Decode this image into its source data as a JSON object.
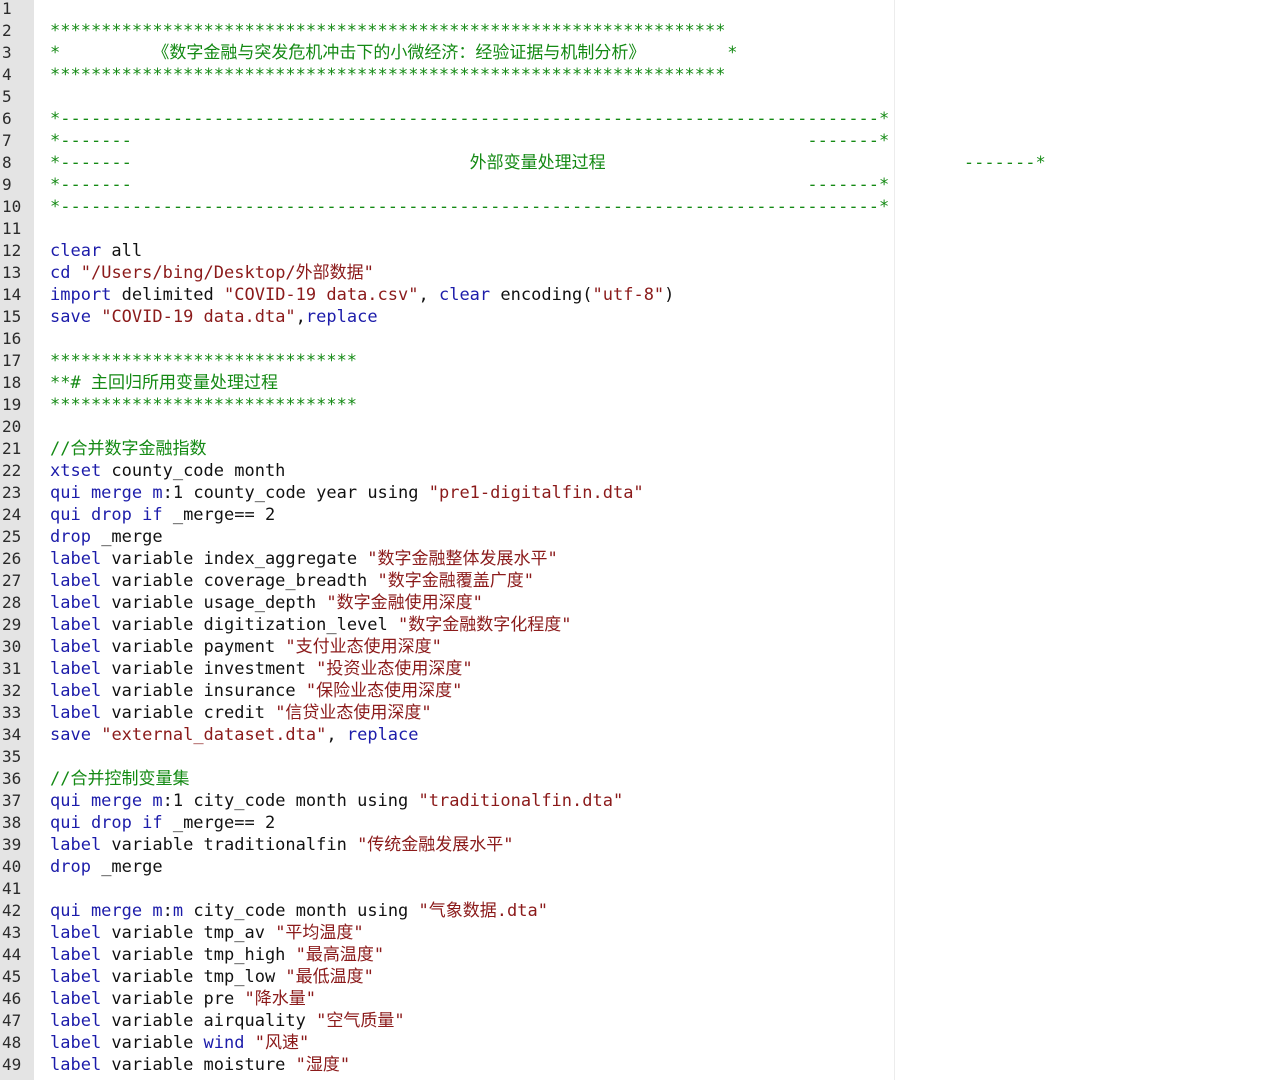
{
  "editor": {
    "line_numbers": [
      "1",
      "2",
      "3",
      "4",
      "5",
      "6",
      "7",
      "8",
      "9",
      "10",
      "11",
      "12",
      "13",
      "14",
      "15",
      "16",
      "17",
      "18",
      "19",
      "20",
      "21",
      "22",
      "23",
      "24",
      "25",
      "26",
      "27",
      "28",
      "29",
      "30",
      "31",
      "32",
      "33",
      "34",
      "35",
      "36",
      "37",
      "38",
      "39",
      "40",
      "41",
      "42",
      "43",
      "44",
      "45",
      "46",
      "47",
      "48",
      "49"
    ],
    "lines": [
      [],
      [
        {
          "t": "comment",
          "v": "******************************************************************"
        }
      ],
      [
        {
          "t": "comment",
          "v": "*         《数字金融与突发危机冲击下的小微经济：经验证据与机制分析》        *"
        }
      ],
      [
        {
          "t": "comment",
          "v": "******************************************************************"
        }
      ],
      [],
      [
        {
          "t": "comment",
          "v": "*--------------------------------------------------------------------------------*"
        }
      ],
      [
        {
          "t": "comment",
          "v": "*-------                                                                  -------*"
        }
      ],
      [
        {
          "t": "comment",
          "v": "*-------                                 外部变量处理过程                                   -------*"
        }
      ],
      [
        {
          "t": "comment",
          "v": "*-------                                                                  -------*"
        }
      ],
      [
        {
          "t": "comment",
          "v": "*--------------------------------------------------------------------------------*"
        }
      ],
      [],
      [
        {
          "t": "cmd",
          "v": "clear"
        },
        {
          "t": "plain",
          "v": " all"
        }
      ],
      [
        {
          "t": "cmd",
          "v": "cd"
        },
        {
          "t": "plain",
          "v": " "
        },
        {
          "t": "str",
          "v": "\"/Users/bing/Desktop/外部数据\""
        }
      ],
      [
        {
          "t": "cmd",
          "v": "import"
        },
        {
          "t": "plain",
          "v": " delimited "
        },
        {
          "t": "str",
          "v": "\"COVID-19 data.csv\""
        },
        {
          "t": "plain",
          "v": ", "
        },
        {
          "t": "cmd",
          "v": "clear"
        },
        {
          "t": "plain",
          "v": " encoding("
        },
        {
          "t": "str",
          "v": "\"utf-8\""
        },
        {
          "t": "plain",
          "v": ")"
        }
      ],
      [
        {
          "t": "cmd",
          "v": "save"
        },
        {
          "t": "plain",
          "v": " "
        },
        {
          "t": "str",
          "v": "\"COVID-19 data.dta\""
        },
        {
          "t": "plain",
          "v": ","
        },
        {
          "t": "cmd",
          "v": "replace"
        }
      ],
      [],
      [
        {
          "t": "comment",
          "v": "******************************"
        }
      ],
      [
        {
          "t": "comment",
          "v": "**# 主回归所用变量处理过程"
        }
      ],
      [
        {
          "t": "comment",
          "v": "******************************"
        }
      ],
      [],
      [
        {
          "t": "comment",
          "v": "//合并数字金融指数"
        }
      ],
      [
        {
          "t": "cmd",
          "v": "xtset"
        },
        {
          "t": "plain",
          "v": " county_code month"
        }
      ],
      [
        {
          "t": "cmd",
          "v": "qui merge"
        },
        {
          "t": "plain",
          "v": " "
        },
        {
          "t": "cmd",
          "v": "m"
        },
        {
          "t": "plain",
          "v": ":1 county_code year using "
        },
        {
          "t": "str",
          "v": "\"pre1-digitalfin.dta\""
        }
      ],
      [
        {
          "t": "cmd",
          "v": "qui drop if"
        },
        {
          "t": "plain",
          "v": " _merge== 2"
        }
      ],
      [
        {
          "t": "cmd",
          "v": "drop"
        },
        {
          "t": "plain",
          "v": " _merge"
        }
      ],
      [
        {
          "t": "cmd",
          "v": "label"
        },
        {
          "t": "plain",
          "v": " variable index_aggregate "
        },
        {
          "t": "str",
          "v": "\"数字金融整体发展水平\""
        }
      ],
      [
        {
          "t": "cmd",
          "v": "label"
        },
        {
          "t": "plain",
          "v": " variable coverage_breadth "
        },
        {
          "t": "str",
          "v": "\"数字金融覆盖广度\""
        }
      ],
      [
        {
          "t": "cmd",
          "v": "label"
        },
        {
          "t": "plain",
          "v": " variable usage_depth "
        },
        {
          "t": "str",
          "v": "\"数字金融使用深度\""
        }
      ],
      [
        {
          "t": "cmd",
          "v": "label"
        },
        {
          "t": "plain",
          "v": " variable digitization_level "
        },
        {
          "t": "str",
          "v": "\"数字金融数字化程度\""
        }
      ],
      [
        {
          "t": "cmd",
          "v": "label"
        },
        {
          "t": "plain",
          "v": " variable payment "
        },
        {
          "t": "str",
          "v": "\"支付业态使用深度\""
        }
      ],
      [
        {
          "t": "cmd",
          "v": "label"
        },
        {
          "t": "plain",
          "v": " variable investment "
        },
        {
          "t": "str",
          "v": "\"投资业态使用深度\""
        }
      ],
      [
        {
          "t": "cmd",
          "v": "label"
        },
        {
          "t": "plain",
          "v": " variable insurance "
        },
        {
          "t": "str",
          "v": "\"保险业态使用深度\""
        }
      ],
      [
        {
          "t": "cmd",
          "v": "label"
        },
        {
          "t": "plain",
          "v": " variable credit "
        },
        {
          "t": "str",
          "v": "\"信贷业态使用深度\""
        }
      ],
      [
        {
          "t": "cmd",
          "v": "save"
        },
        {
          "t": "plain",
          "v": " "
        },
        {
          "t": "str",
          "v": "\"external_dataset.dta\""
        },
        {
          "t": "plain",
          "v": ", "
        },
        {
          "t": "cmd",
          "v": "replace"
        }
      ],
      [],
      [
        {
          "t": "comment",
          "v": "//合并控制变量集"
        }
      ],
      [
        {
          "t": "cmd",
          "v": "qui merge"
        },
        {
          "t": "plain",
          "v": " "
        },
        {
          "t": "cmd",
          "v": "m"
        },
        {
          "t": "plain",
          "v": ":1 city_code month using "
        },
        {
          "t": "str",
          "v": "\"traditionalfin.dta\""
        }
      ],
      [
        {
          "t": "cmd",
          "v": "qui drop if"
        },
        {
          "t": "plain",
          "v": " _merge== 2"
        }
      ],
      [
        {
          "t": "cmd",
          "v": "label"
        },
        {
          "t": "plain",
          "v": " variable traditionalfin "
        },
        {
          "t": "str",
          "v": "\"传统金融发展水平\""
        }
      ],
      [
        {
          "t": "cmd",
          "v": "drop"
        },
        {
          "t": "plain",
          "v": " _merge"
        }
      ],
      [],
      [
        {
          "t": "cmd",
          "v": "qui merge"
        },
        {
          "t": "plain",
          "v": " "
        },
        {
          "t": "cmd",
          "v": "m"
        },
        {
          "t": "plain",
          "v": ":"
        },
        {
          "t": "cmd",
          "v": "m"
        },
        {
          "t": "plain",
          "v": " city_code month using "
        },
        {
          "t": "str",
          "v": "\"气象数据.dta\""
        }
      ],
      [
        {
          "t": "cmd",
          "v": "label"
        },
        {
          "t": "plain",
          "v": " variable tmp_av "
        },
        {
          "t": "str",
          "v": "\"平均温度\""
        }
      ],
      [
        {
          "t": "cmd",
          "v": "label"
        },
        {
          "t": "plain",
          "v": " variable tmp_high "
        },
        {
          "t": "str",
          "v": "\"最高温度\""
        }
      ],
      [
        {
          "t": "cmd",
          "v": "label"
        },
        {
          "t": "plain",
          "v": " variable tmp_low "
        },
        {
          "t": "str",
          "v": "\"最低温度\""
        }
      ],
      [
        {
          "t": "cmd",
          "v": "label"
        },
        {
          "t": "plain",
          "v": " variable pre "
        },
        {
          "t": "str",
          "v": "\"降水量\""
        }
      ],
      [
        {
          "t": "cmd",
          "v": "label"
        },
        {
          "t": "plain",
          "v": " variable airquality "
        },
        {
          "t": "str",
          "v": "\"空气质量\""
        }
      ],
      [
        {
          "t": "cmd",
          "v": "label"
        },
        {
          "t": "plain",
          "v": " variable "
        },
        {
          "t": "cmd",
          "v": "wind"
        },
        {
          "t": "plain",
          "v": " "
        },
        {
          "t": "str",
          "v": "\"风速\""
        }
      ],
      [
        {
          "t": "cmd",
          "v": "label"
        },
        {
          "t": "plain",
          "v": " variable moisture "
        },
        {
          "t": "str",
          "v": "\"湿度\""
        }
      ]
    ]
  },
  "colors": {
    "comment": "#148a14",
    "command": "#1c1caa",
    "string": "#8b1a1a",
    "plain": "#111111",
    "gutter_bg": "#e4e4e4"
  }
}
